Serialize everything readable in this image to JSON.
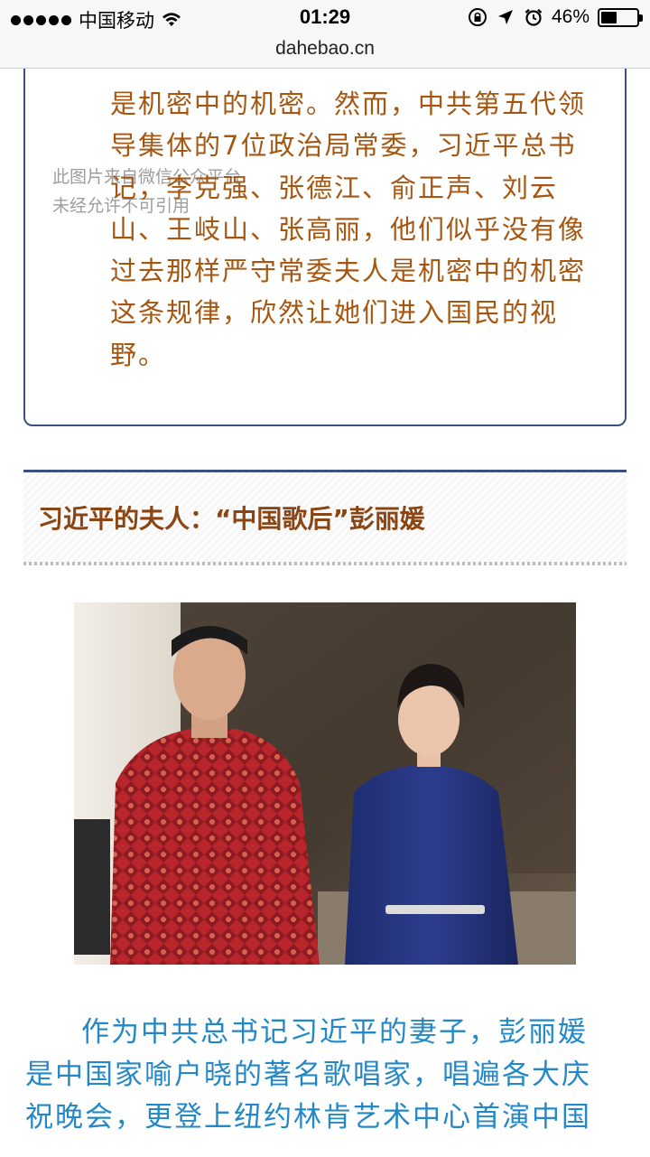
{
  "status_bar": {
    "carrier": "中国移动",
    "time": "01:29",
    "battery_text": "46%",
    "battery_level": 0.46,
    "icons": [
      "signal-dots-icon",
      "wifi-icon",
      "orientation-lock-icon",
      "location-arrow-icon",
      "alarm-clock-icon",
      "battery-icon"
    ]
  },
  "browser": {
    "url": "dahebao.cn"
  },
  "quote": {
    "lines": [
      "是机密中的机密。然而，中共第五代领",
      "导集体的7位政治局常委，习近平总书",
      "记，李克强、张德江、俞正声、刘云",
      "山、王岐山、张高丽，他们似乎没有像",
      "过去那样严守常委夫人是机密中的机密",
      "这条规律，欣然让她们进入国民的视",
      "野。"
    ],
    "watermark_lines": [
      "此图片来自微信公众平台",
      "未经允许不可引用"
    ],
    "colors": {
      "text": "#a55610",
      "border": "#3d4e86"
    }
  },
  "section": {
    "title": "习近平的夫人：“中国歌后”彭丽媛",
    "colors": {
      "title": "#8a4512"
    }
  },
  "photo": {
    "description_icon": "photo-image"
  },
  "body": {
    "lines": [
      "作为中共总书记习近平的妻子，彭丽媛",
      "是中国家喻户晓的著名歌唱家，唱遍各大庆",
      "祝晚会，更登上纽约林肯艺术中心首演中国"
    ],
    "colors": {
      "text": "#2488c6"
    }
  }
}
